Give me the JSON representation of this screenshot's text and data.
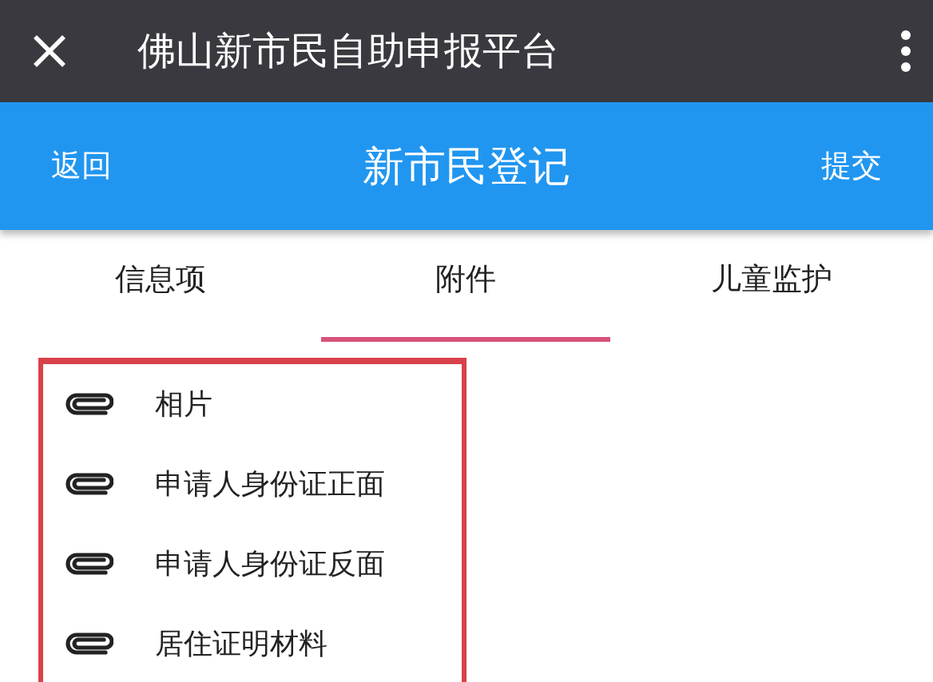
{
  "window": {
    "title": "佛山新市民自助申报平台"
  },
  "nav_bar": {
    "back": "返回",
    "title": "新市民登记",
    "submit": "提交"
  },
  "tabs": [
    {
      "label": "信息项",
      "selected": false
    },
    {
      "label": "附件",
      "selected": true
    },
    {
      "label": "儿童监护",
      "selected": false
    }
  ],
  "attachments": [
    {
      "label": "相片"
    },
    {
      "label": "申请人身份证正面"
    },
    {
      "label": "申请人身份证反面"
    },
    {
      "label": "居住证明材料"
    }
  ]
}
